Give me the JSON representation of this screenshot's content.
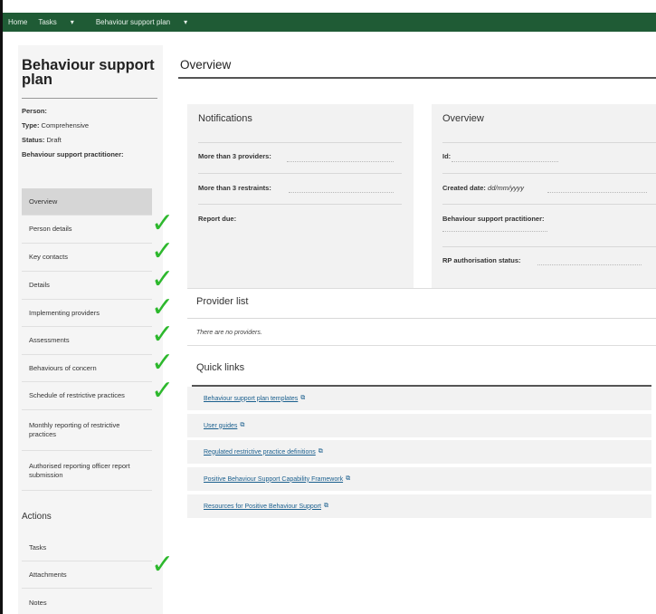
{
  "topbar": {
    "items": [
      {
        "label": "Home",
        "has_caret": false
      },
      {
        "label": "Tasks",
        "has_caret": true
      },
      {
        "label": "Behaviour support plan",
        "has_caret": true
      }
    ],
    "caret_icon": "chevron-down-icon",
    "background": "#1f5b35"
  },
  "sidebar": {
    "title": "Behaviour support plan",
    "meta": {
      "person_label": "Person:",
      "type_label": "Type:",
      "type_value": "Comprehensive",
      "status_label": "Status:",
      "status_value": "Draft",
      "practitioner_label": "Behaviour support practitioner:"
    },
    "nav": [
      {
        "label": "Overview",
        "active": true,
        "checked": false
      },
      {
        "label": "Person details",
        "active": false,
        "checked": true
      },
      {
        "label": "Key contacts",
        "active": false,
        "checked": true
      },
      {
        "label": "Details",
        "active": false,
        "checked": true
      },
      {
        "label": "Implementing providers",
        "active": false,
        "checked": true
      },
      {
        "label": "Assessments",
        "active": false,
        "checked": true
      },
      {
        "label": "Behaviours of concern",
        "active": false,
        "checked": true
      },
      {
        "label": "Schedule of restrictive practices",
        "active": false,
        "checked": true
      },
      {
        "label": "Monthly reporting of restrictive practices",
        "active": false,
        "checked": false
      },
      {
        "label": "Authorised reporting officer report submission",
        "active": false,
        "checked": false
      }
    ],
    "actions_heading": "Actions",
    "actions": [
      {
        "label": "Tasks",
        "checked": false
      },
      {
        "label": "Attachments",
        "checked": true
      },
      {
        "label": "Notes",
        "checked": false
      }
    ],
    "check_icon": "check-mark-icon",
    "check_color": "#2db82d"
  },
  "main": {
    "title": "Overview",
    "notifications": {
      "title": "Notifications",
      "rows": [
        {
          "label": "More than 3 providers:"
        },
        {
          "label": "More than 3 restraints:"
        },
        {
          "label": "Report due:"
        }
      ]
    },
    "overview_card": {
      "title": "Overview",
      "id_label": "Id:",
      "created_label": "Created date:",
      "created_value": "dd/mm/yyyy",
      "practitioner_label": "Behaviour support practitioner:",
      "rp_label": "RP authorisation status:"
    },
    "provider_list": {
      "title": "Provider list",
      "empty_text": "There are no providers."
    },
    "quick_links": {
      "title": "Quick links",
      "external_icon": "external-link-icon",
      "links": [
        "Behaviour support plan templates",
        "User guides",
        "Regulated restrictive practice definitions",
        "Positive Behaviour Support Capability Framework",
        "Resources for Positive Behaviour Support"
      ]
    }
  }
}
